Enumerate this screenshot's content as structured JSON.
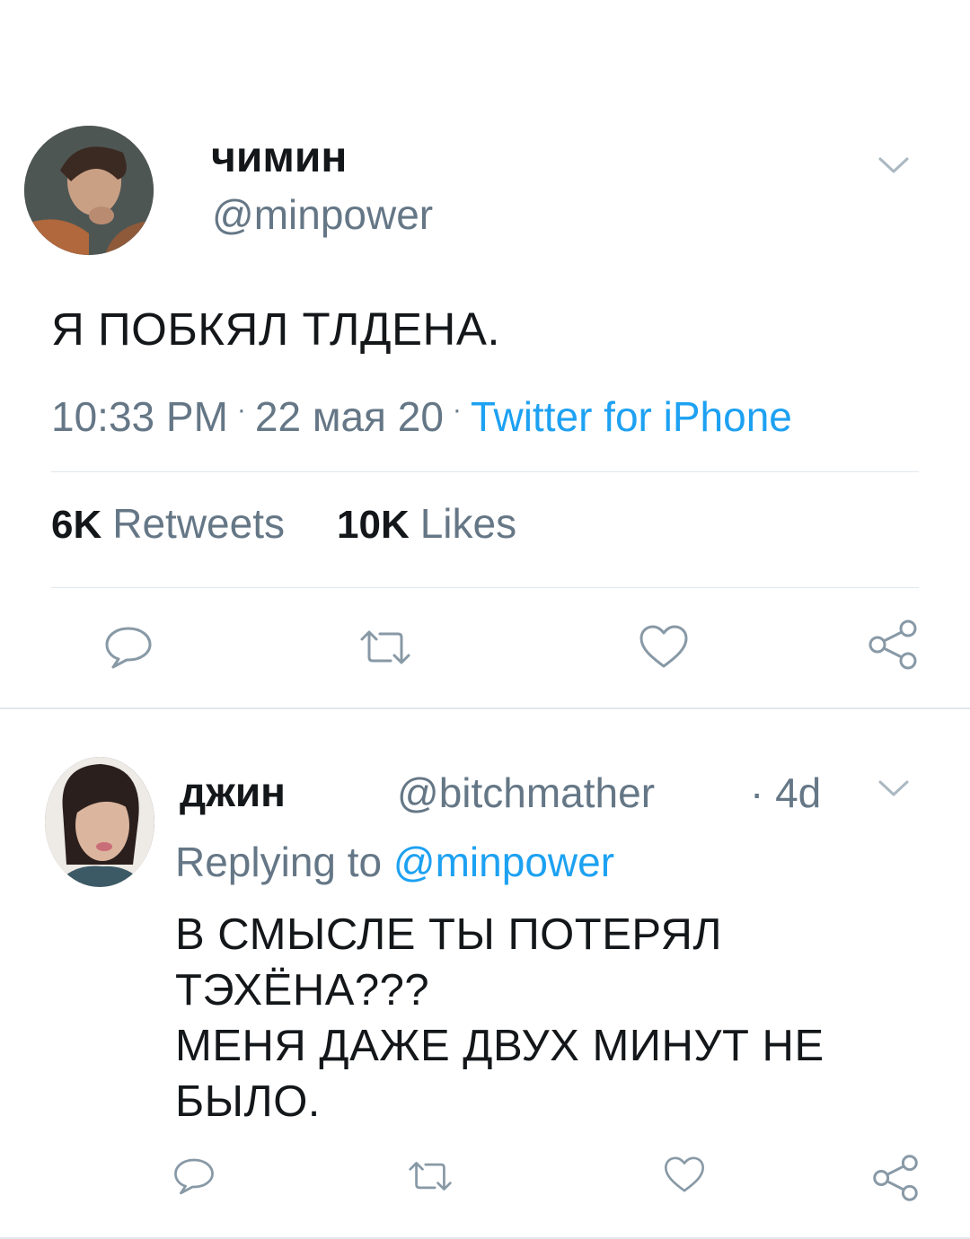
{
  "main_tweet": {
    "display_name": "чимин",
    "handle": "@minpower",
    "text": "Я ПОБКЯЛ ТЛДЕНА.",
    "time": "10:33 PM",
    "date": "22 мая 20",
    "separator": "·",
    "source": "Twitter for iPhone",
    "retweets_count": "6K",
    "retweets_label": "Retweets",
    "likes_count": "10K",
    "likes_label": "Likes"
  },
  "reply_tweet": {
    "display_name": "джин",
    "handle": "@bitchmather",
    "time": "· 4d",
    "replying_prefix": "Replying to ",
    "replying_mention": "@minpower",
    "text": "В СМЫСЛЕ ТЫ ПОТЕРЯЛ\nТЭХЁНА???\nМЕНЯ ДАЖЕ ДВУХ МИНУТ НЕ\nБЫЛО."
  },
  "icons": {
    "reply": "reply-icon",
    "retweet": "retweet-icon",
    "like": "heart-icon",
    "share": "share-icon",
    "menu": "chevron-down-icon"
  },
  "colors": {
    "text": "#14171a",
    "secondary": "#657786",
    "link": "#1da1f2",
    "divider": "#e1e8ed",
    "icon": "#8899a6"
  }
}
